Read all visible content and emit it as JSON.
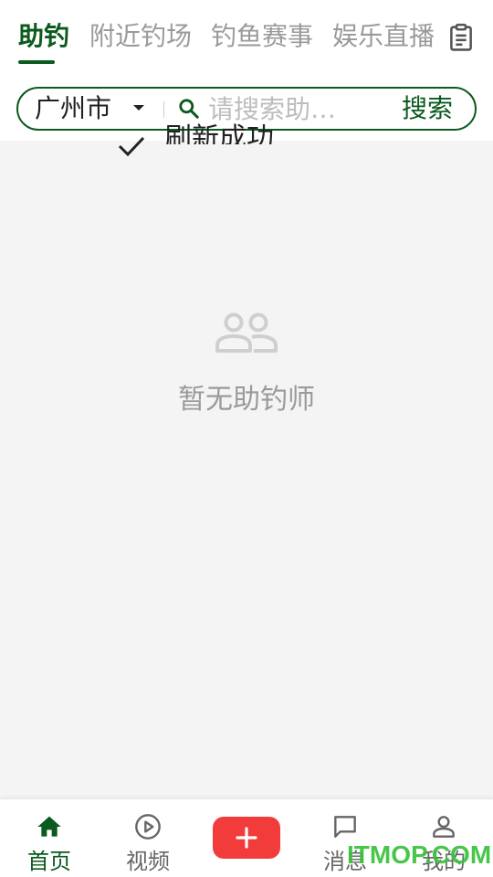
{
  "tabs": [
    {
      "label": "助钓",
      "active": true
    },
    {
      "label": "附近钓场",
      "active": false
    },
    {
      "label": "钓鱼赛事",
      "active": false
    },
    {
      "label": "娱乐直播",
      "active": false
    }
  ],
  "header": {
    "right_icon": "clipboard-icon"
  },
  "search": {
    "city": "广州市",
    "placeholder": "请搜索助…",
    "value": "",
    "button_label": "搜索"
  },
  "peek": {
    "text": "刷新成功"
  },
  "empty_state": {
    "icon": "users-icon",
    "text": "暂无助钓师"
  },
  "bottom_nav": {
    "items": [
      {
        "label": "首页",
        "icon": "home-icon",
        "active": true
      },
      {
        "label": "视频",
        "icon": "play-circle-icon",
        "active": false
      },
      {
        "label": "消息",
        "icon": "chat-icon",
        "active": false
      },
      {
        "label": "我的",
        "icon": "user-icon",
        "active": false
      }
    ],
    "center_button_icon": "plus-icon"
  },
  "watermark": "ITMOP.COM",
  "colors": {
    "brand_green": "#0b5a1e",
    "accent_red": "#f23c3c",
    "content_bg": "#f4f4f4",
    "inactive_text": "#9a9a9a",
    "watermark_green": "#39c23a"
  }
}
